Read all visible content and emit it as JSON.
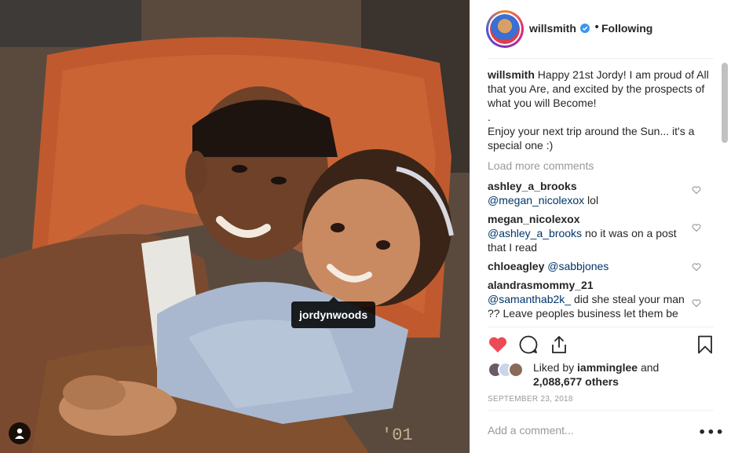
{
  "photo": {
    "alt_tag": "jordynwoods",
    "stamp": "'01"
  },
  "header": {
    "username": "willsmith",
    "separator": "•",
    "follow_status": "Following"
  },
  "caption": {
    "username": "willsmith",
    "text": "Happy 21st Jordy! I am proud of All that you Are, and excited by the prospects of what you will Become!\n.\nEnjoy your next trip around the Sun... it's a special one :)"
  },
  "load_more": "Load more comments",
  "comments": [
    {
      "username": "ashley_a_brooks",
      "mention": "@megan_nicolexox",
      "text": " lol"
    },
    {
      "username": "megan_nicolexox",
      "mention": "@ashley_a_brooks",
      "text": " no it was on a post that I read"
    },
    {
      "username": "chloeagley",
      "mention": "@sabbjones",
      "text": ""
    },
    {
      "username": "alandrasmommy_21",
      "mention": "@samanthab2k_",
      "text": " did she steal your man ?? Leave peoples business let them be"
    }
  ],
  "likes": {
    "prefix": "Liked by ",
    "liker": "iamminglee",
    "middle": " and",
    "count": "2,088,677 others"
  },
  "date": "SEPTEMBER 23, 2018",
  "add_comment_placeholder": "Add a comment...",
  "more_label": "•••",
  "colors": {
    "like_red": "#ed4956",
    "verified_blue": "#3897f0",
    "mention_blue": "#003569",
    "muted_gray": "#999999"
  }
}
